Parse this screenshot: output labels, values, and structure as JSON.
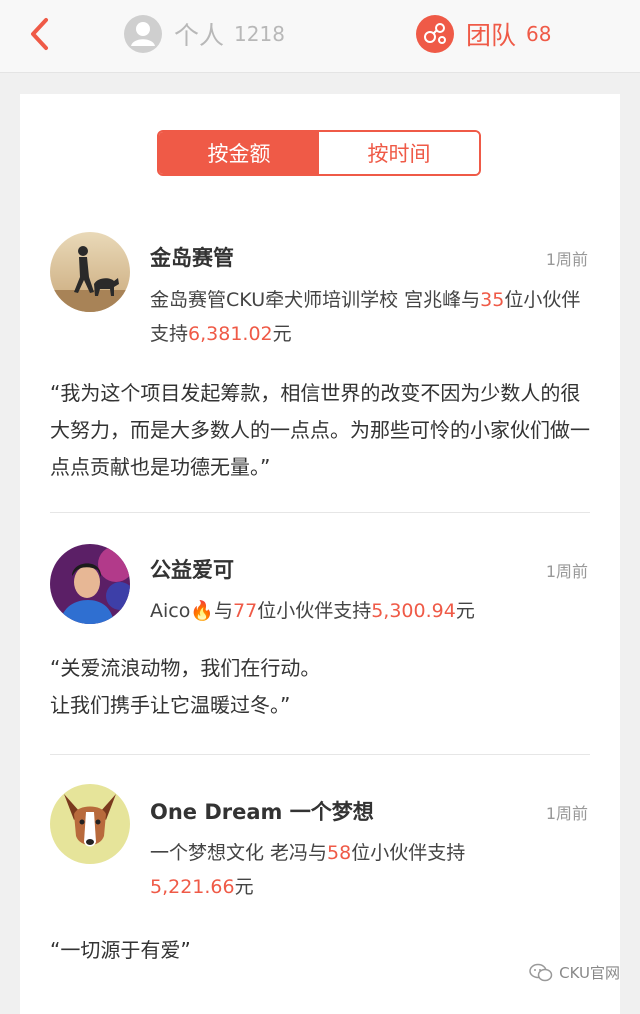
{
  "header": {
    "personal_tab": {
      "label": "个人",
      "count": "1218",
      "icon": "person-icon"
    },
    "team_tab": {
      "label": "团队",
      "count": "68",
      "icon": "team-icon"
    },
    "back_icon": "chevron-left-icon",
    "accent_color": "#ef5a47"
  },
  "sort": {
    "by_amount": "按金额",
    "by_time": "按时间",
    "selected": "按金额"
  },
  "entries": [
    {
      "name": "金岛赛管",
      "time": "1周前",
      "summary": {
        "prefix": "金岛赛管CKU牵犬师培训学校 宫兆峰与",
        "count": "35",
        "middle": "位小伙伴支持",
        "amount": "6,381.02",
        "suffix": "元"
      },
      "quote": "“我为这个项目发起筹款，相信世界的改变不因为少数人的很大努力，而是大多数人的一点点。为那些可怜的小家伙们做一点点贡献也是功德无量。”"
    },
    {
      "name": "公益爱可",
      "time": "1周前",
      "summary": {
        "prefix": "Aico🔥与",
        "count": "77",
        "middle": "位小伙伴支持",
        "amount": "5,300.94",
        "suffix": "元"
      },
      "quote_lines": [
        "“关爱流浪动物，我们在行动。",
        "让我们携手让它温暖过冬。”"
      ]
    },
    {
      "name": "One Dream 一个梦想",
      "time": "1周前",
      "summary": {
        "prefix": "一个梦想文化 老冯与",
        "count": "58",
        "middle": "位小伙伴支持",
        "amount": "5,221.66",
        "suffix": "元"
      },
      "quote": "“一切源于有爱”"
    }
  ],
  "watermark": "CKU官网"
}
